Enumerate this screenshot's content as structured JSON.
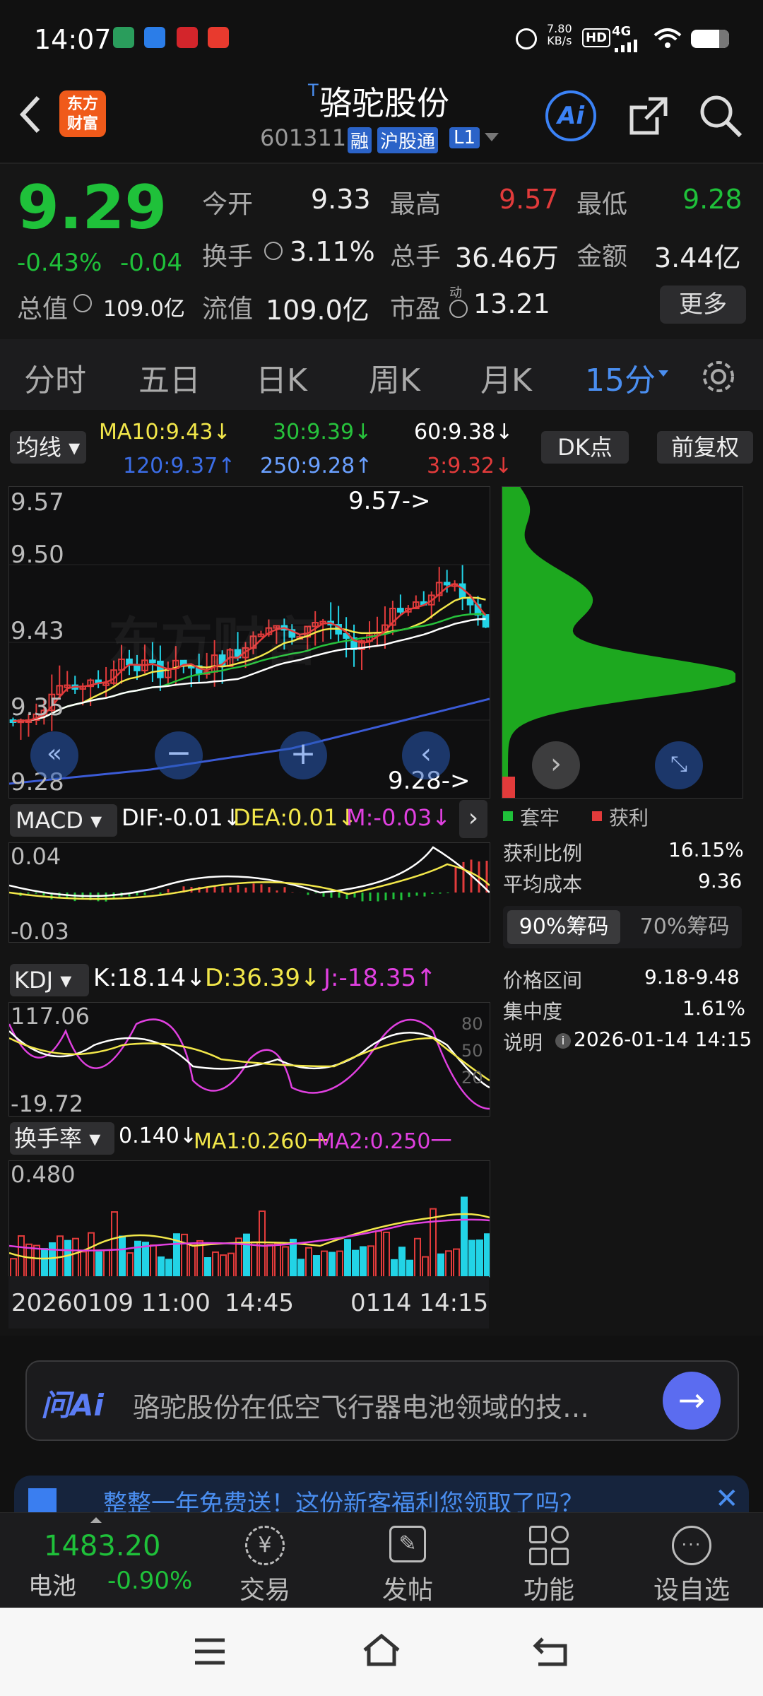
{
  "status": {
    "time": "14:07",
    "net_speed": "7.80",
    "net_unit": "KB/s",
    "hd": "HD",
    "signal": "4G"
  },
  "header": {
    "logo_line1": "东方",
    "logo_line2": "财富",
    "title": "骆驼股份",
    "title_mark": "T",
    "code": "601311",
    "badge_rong": "融",
    "badge_market": "沪股通",
    "badge_level": "L1",
    "ai_label": "Ai"
  },
  "quote": {
    "price": "9.29",
    "change_pct": "-0.43%",
    "change": "-0.04",
    "open_label": "今开",
    "open": "9.33",
    "high_label": "最高",
    "high": "9.57",
    "low_label": "最低",
    "low": "9.28",
    "turnover_label": "换手",
    "turnover": "3.11%",
    "volume_label": "总手",
    "volume": "36.46万",
    "amount_label": "金额",
    "amount": "3.44亿",
    "mktcap_label": "总值",
    "mktcap": "109.0亿",
    "float_label": "流值",
    "float_cap": "109.0亿",
    "pe_label": "市盈",
    "pe_sup": "动",
    "pe": "13.21",
    "more": "更多"
  },
  "tabs": [
    "分时",
    "五日",
    "日K",
    "周K",
    "月K",
    "15分"
  ],
  "ma": {
    "selector": "均线",
    "ma10": "MA10:9.43↓",
    "ma30": "30:9.39↓",
    "ma60": "60:9.38↓",
    "ma120": "120:9.37↑",
    "ma250": "250:9.28↑",
    "ma3": "3:9.32↓",
    "dk": "DK点",
    "adjust": "前复权"
  },
  "kchart": {
    "y_labels": [
      "9.57",
      "9.50",
      "9.43",
      "9.35",
      "9.28"
    ],
    "high_note": "9.57->",
    "low_note": "9.28->",
    "watermark": "东方财富"
  },
  "macd": {
    "label": "MACD",
    "dif": "DIF:-0.01↓",
    "dea": "DEA:0.01↓",
    "m": "M:-0.03↓",
    "ymax": "0.04",
    "ymin": "-0.03"
  },
  "kdj": {
    "label": "KDJ",
    "k": "K:18.14↓",
    "d": "D:36.39↓",
    "j": "J:-18.35↑",
    "ymax": "117.06",
    "ymin": "-19.72",
    "r80": "80",
    "r50": "50",
    "r20": "20"
  },
  "turn": {
    "label": "换手率",
    "value": "0.140↓",
    "ma1": "MA1:0.260一",
    "ma2": "MA2:0.250一",
    "ymax": "0.480"
  },
  "xaxis": {
    "left": "20260109 11:00",
    "mid": "14:45",
    "right": "0114 14:15"
  },
  "chips": {
    "trapped": "套牢",
    "profit": "获利",
    "rows": [
      {
        "label": "获利比例",
        "value": "16.15%"
      },
      {
        "label": "平均成本",
        "value": "9.36"
      }
    ],
    "tab90": "90%筹码",
    "tab70": "70%筹码",
    "rows2": [
      {
        "label": "价格区间",
        "value": "9.18-9.48"
      },
      {
        "label": "集中度",
        "value": "1.61%"
      },
      {
        "label": "说明",
        "value": "2026-01-14 14:15"
      }
    ]
  },
  "ai": {
    "logo": "问Ai",
    "prompt": "骆驼股份在低空飞行器电池领域的技…"
  },
  "banner": {
    "text": "整整一年免费送！这份新客福利您领取了吗？"
  },
  "bottom": {
    "index_value": "1483.20",
    "index_name": "电池",
    "index_change": "-0.90%",
    "trade": "交易",
    "post": "发帖",
    "func": "功能",
    "watch": "设自选"
  },
  "colors": {
    "accent": "#4a8ef0",
    "up": "#e23b3b",
    "down": "#1fc13a",
    "ma10": "#f2e74a",
    "ma30": "#27c23c",
    "ma60": "#ffffff",
    "ma120": "#3b5bd6",
    "ma250": "#6aa0ff",
    "magenta": "#e040e0"
  }
}
